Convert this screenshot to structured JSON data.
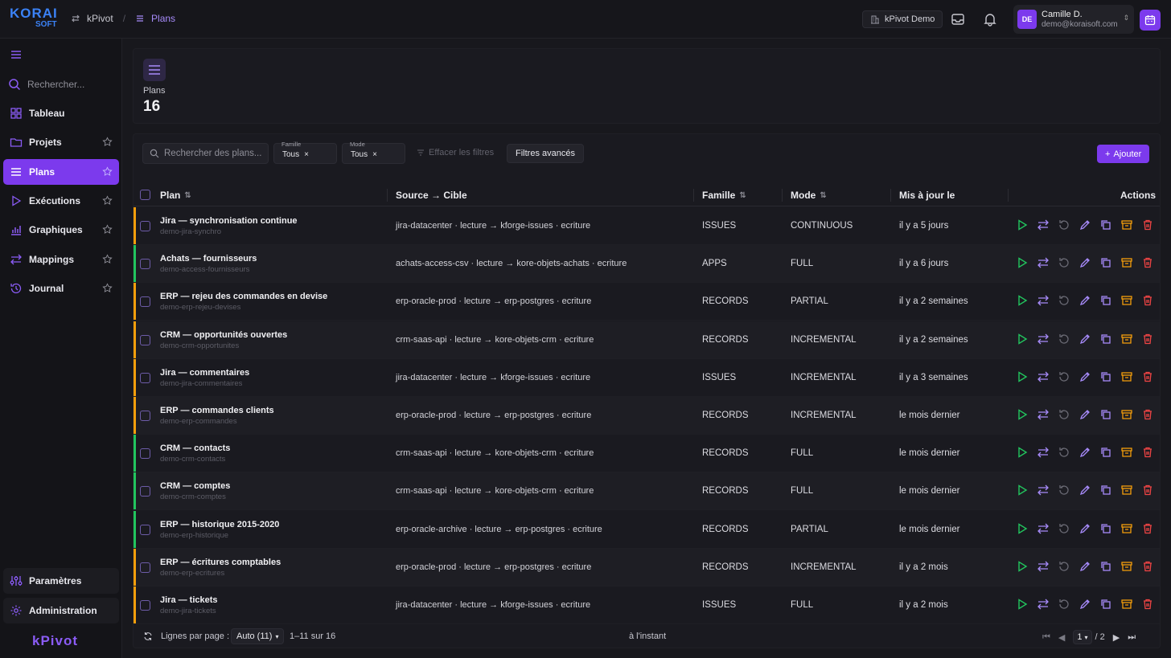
{
  "brand": {
    "logo_line1": "KORAI",
    "logo_line2": "SOFT",
    "bottom": "kPivot"
  },
  "breadcrumb": {
    "root": "kPivot",
    "current": "Plans"
  },
  "topbar": {
    "env_label": "kPivot Demo"
  },
  "user": {
    "initials": "DE",
    "name": "Camille D.",
    "email": "demo@koraisoft.com"
  },
  "sidebar": {
    "search_placeholder": "Rechercher...",
    "items": [
      {
        "label": "Tableau",
        "icon": "grid-icon",
        "star": false
      },
      {
        "label": "Projets",
        "icon": "folder-icon",
        "star": true
      },
      {
        "label": "Plans",
        "icon": "list-icon",
        "star": true,
        "active": true
      },
      {
        "label": "Exécutions",
        "icon": "play-icon",
        "star": true
      },
      {
        "label": "Graphiques",
        "icon": "chart-icon",
        "star": true
      },
      {
        "label": "Mappings",
        "icon": "mapping-icon",
        "star": true
      },
      {
        "label": "Journal",
        "icon": "history-icon",
        "star": true
      }
    ],
    "bottom_items": [
      {
        "label": "Paramètres",
        "icon": "sliders-icon"
      },
      {
        "label": "Administration",
        "icon": "gear-icon"
      }
    ]
  },
  "stat": {
    "label": "Plans",
    "value": "16"
  },
  "filters": {
    "search_placeholder": "Rechercher des plans...",
    "famille_caption": "Famille",
    "famille_value": "Tous",
    "mode_caption": "Mode",
    "mode_value": "Tous",
    "clear_label": "Effacer les filtres",
    "advanced_label": "Filtres avancés",
    "add_label": "Ajouter"
  },
  "columns": {
    "plan": "Plan",
    "source": "Source → Cible",
    "famille": "Famille",
    "mode": "Mode",
    "updated": "Mis à jour le",
    "actions": "Actions"
  },
  "rows": [
    {
      "name": "Jira — synchronisation continue",
      "id": "demo-jira-synchro",
      "src": "jira-datacenter · lecture",
      "dst": "kforge-issues · ecriture",
      "famille": "ISSUES",
      "mode": "CONTINUOUS",
      "updated": "il y a 5 jours",
      "status": "#f59e0b"
    },
    {
      "name": "Achats — fournisseurs",
      "id": "demo-access-fournisseurs",
      "src": "achats-access-csv · lecture",
      "dst": "kore-objets-achats · ecriture",
      "famille": "APPS",
      "mode": "FULL",
      "updated": "il y a 6 jours",
      "status": "#22c55e"
    },
    {
      "name": "ERP — rejeu des commandes en devise",
      "id": "demo-erp-rejeu-devises",
      "src": "erp-oracle-prod · lecture",
      "dst": "erp-postgres · ecriture",
      "famille": "RECORDS",
      "mode": "PARTIAL",
      "updated": "il y a 2 semaines",
      "status": "#f59e0b"
    },
    {
      "name": "CRM — opportunités ouvertes",
      "id": "demo-crm-opportunites",
      "src": "crm-saas-api · lecture",
      "dst": "kore-objets-crm · ecriture",
      "famille": "RECORDS",
      "mode": "INCREMENTAL",
      "updated": "il y a 2 semaines",
      "status": "#f59e0b"
    },
    {
      "name": "Jira — commentaires",
      "id": "demo-jira-commentaires",
      "src": "jira-datacenter · lecture",
      "dst": "kforge-issues · ecriture",
      "famille": "ISSUES",
      "mode": "INCREMENTAL",
      "updated": "il y a 3 semaines",
      "status": "#f59e0b"
    },
    {
      "name": "ERP — commandes clients",
      "id": "demo-erp-commandes",
      "src": "erp-oracle-prod · lecture",
      "dst": "erp-postgres · ecriture",
      "famille": "RECORDS",
      "mode": "INCREMENTAL",
      "updated": "le mois dernier",
      "status": "#f59e0b"
    },
    {
      "name": "CRM — contacts",
      "id": "demo-crm-contacts",
      "src": "crm-saas-api · lecture",
      "dst": "kore-objets-crm · ecriture",
      "famille": "RECORDS",
      "mode": "FULL",
      "updated": "le mois dernier",
      "status": "#22c55e"
    },
    {
      "name": "CRM — comptes",
      "id": "demo-crm-comptes",
      "src": "crm-saas-api · lecture",
      "dst": "kore-objets-crm · ecriture",
      "famille": "RECORDS",
      "mode": "FULL",
      "updated": "le mois dernier",
      "status": "#22c55e"
    },
    {
      "name": "ERP — historique 2015-2020",
      "id": "demo-erp-historique",
      "src": "erp-oracle-archive · lecture",
      "dst": "erp-postgres · ecriture",
      "famille": "RECORDS",
      "mode": "PARTIAL",
      "updated": "le mois dernier",
      "status": "#22c55e"
    },
    {
      "name": "ERP — écritures comptables",
      "id": "demo-erp-ecritures",
      "src": "erp-oracle-prod · lecture",
      "dst": "erp-postgres · ecriture",
      "famille": "RECORDS",
      "mode": "INCREMENTAL",
      "updated": "il y a 2 mois",
      "status": "#f59e0b"
    },
    {
      "name": "Jira — tickets",
      "id": "demo-jira-tickets",
      "src": "jira-datacenter · lecture",
      "dst": "kforge-issues · ecriture",
      "famille": "ISSUES",
      "mode": "FULL",
      "updated": "il y a 2 mois",
      "status": "#f59e0b"
    }
  ],
  "footer": {
    "rows_per_page_label": "Lignes par page :",
    "rows_per_page_value": "Auto (11)",
    "range": "1–11 sur 16",
    "refreshed": "à l'instant",
    "page_value": "1",
    "page_total": "/ 2"
  },
  "colors": {
    "accent": "#7c3aed",
    "play": "#22c55e",
    "archive": "#f59e0b",
    "delete": "#ef4444",
    "edit": "#a78bfa"
  }
}
